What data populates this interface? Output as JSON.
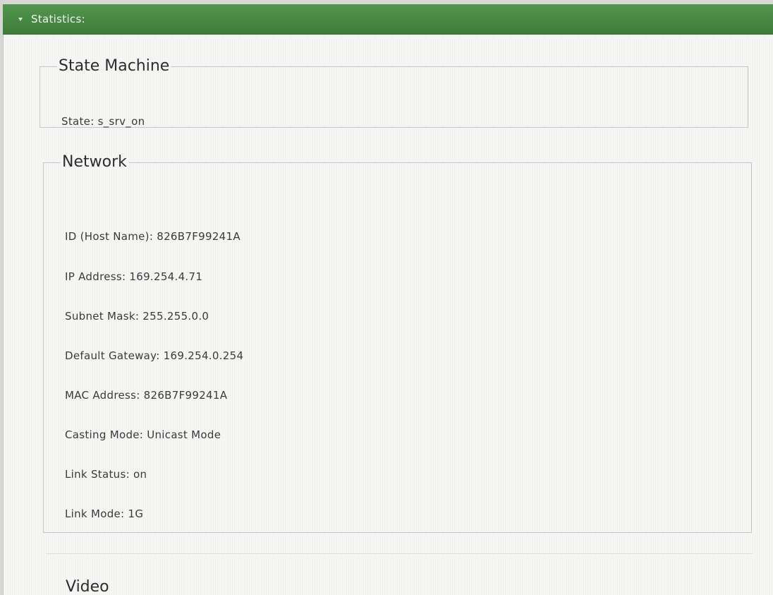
{
  "panel": {
    "header_title": "Statistics:",
    "header_icon": "triangle-down-icon",
    "colors": {
      "header_green": "#4a8a46",
      "header_text": "#eef5ec",
      "body_bg": "#f6f6f4",
      "border": "#c4c6c9"
    }
  },
  "state_machine": {
    "legend": "State Machine",
    "fields": [
      {
        "text": "State: s_srv_on"
      }
    ]
  },
  "network": {
    "legend": "Network",
    "fields": [
      {
        "text": "ID (Host Name): 826B7F99241A"
      },
      {
        "text": "IP Address: 169.254.4.71"
      },
      {
        "text": "Subnet Mask: 255.255.0.0"
      },
      {
        "text": "Default Gateway: 169.254.0.254"
      },
      {
        "text": "MAC Address: 826B7F99241A"
      },
      {
        "text": "Casting Mode: Unicast Mode"
      },
      {
        "text": "Link Status: on"
      },
      {
        "text": "Link Mode: 1G"
      }
    ]
  },
  "video": {
    "heading": "Video"
  }
}
